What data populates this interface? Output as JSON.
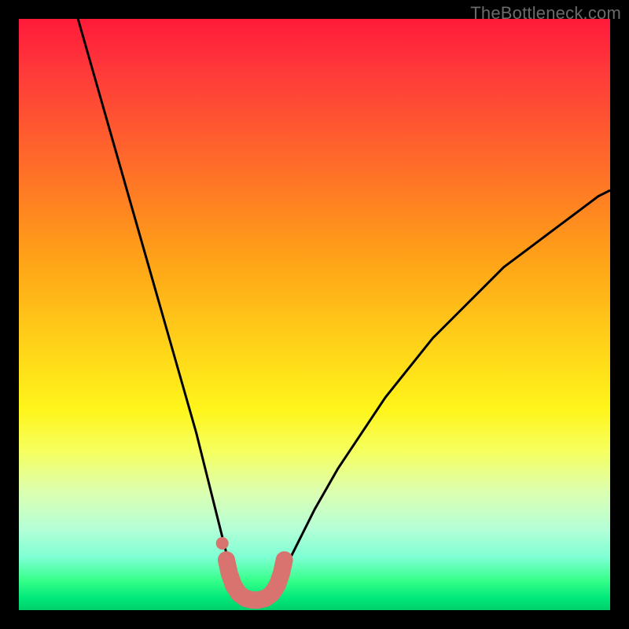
{
  "watermark": "TheBottleneck.com",
  "chart_data": {
    "type": "line",
    "title": "",
    "xlabel": "",
    "ylabel": "",
    "xlim": [
      0,
      100
    ],
    "ylim": [
      0,
      100
    ],
    "series": [
      {
        "name": "left-branch",
        "stroke": "#000000",
        "stroke_width": 3,
        "x": [
          10,
          12,
          14,
          16,
          18,
          20,
          22,
          24,
          26,
          28,
          30,
          31,
          32,
          33,
          34,
          35,
          36,
          37,
          37.5
        ],
        "y": [
          100,
          93,
          86,
          79,
          72,
          65,
          58,
          51,
          44,
          37,
          30,
          26,
          22,
          18,
          14,
          10,
          7,
          4,
          3
        ]
      },
      {
        "name": "right-branch",
        "stroke": "#000000",
        "stroke_width": 3,
        "x": [
          42.5,
          43,
          44,
          46,
          48,
          50,
          54,
          58,
          62,
          66,
          70,
          74,
          78,
          82,
          86,
          90,
          94,
          98,
          100
        ],
        "y": [
          3,
          4,
          6,
          9,
          13,
          17,
          24,
          30,
          36,
          41,
          46,
          50,
          54,
          58,
          61,
          64,
          67,
          70,
          71
        ]
      },
      {
        "name": "valley-band",
        "stroke": "#d8736f",
        "stroke_width": 22,
        "linecap": "round",
        "x": [
          35.1,
          35.6,
          36.3,
          37.2,
          38.3,
          39.5,
          40.5,
          41.7,
          42.8,
          43.7,
          44.4,
          44.9
        ],
        "y": [
          8.5,
          6.2,
          4.2,
          2.8,
          2.0,
          1.7,
          1.7,
          2.0,
          2.8,
          4.2,
          6.2,
          8.5
        ]
      },
      {
        "name": "dot-marker",
        "stroke": "#d8736f",
        "marker": "circle",
        "marker_radius": 8,
        "x": [
          34.4
        ],
        "y": [
          11.3
        ]
      }
    ],
    "background_gradient": {
      "stops": [
        {
          "pos": 0.0,
          "color": "#ff1a3a"
        },
        {
          "pos": 0.09,
          "color": "#ff3a3a"
        },
        {
          "pos": 0.24,
          "color": "#ff6a2a"
        },
        {
          "pos": 0.4,
          "color": "#ffa018"
        },
        {
          "pos": 0.55,
          "color": "#ffd219"
        },
        {
          "pos": 0.66,
          "color": "#fff51a"
        },
        {
          "pos": 0.73,
          "color": "#f6ff5e"
        },
        {
          "pos": 0.8,
          "color": "#dcffb0"
        },
        {
          "pos": 0.86,
          "color": "#b7ffd6"
        },
        {
          "pos": 0.91,
          "color": "#7fffd4"
        },
        {
          "pos": 0.95,
          "color": "#36ff8a"
        },
        {
          "pos": 0.98,
          "color": "#00e87a"
        },
        {
          "pos": 1.0,
          "color": "#00cf6a"
        }
      ]
    }
  }
}
